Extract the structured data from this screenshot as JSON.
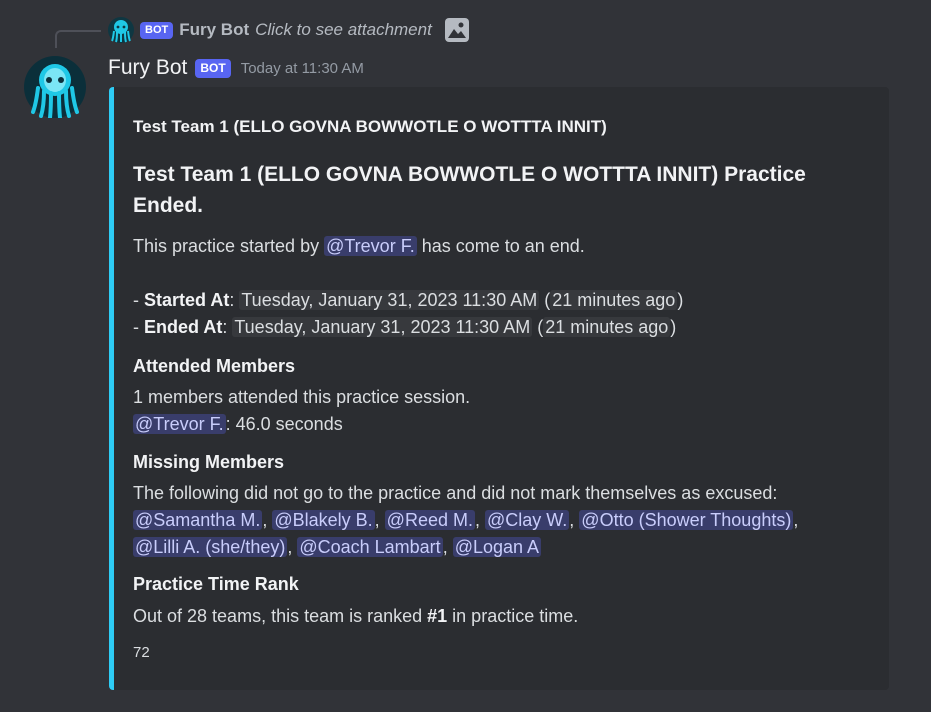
{
  "reply": {
    "author": "Fury Bot",
    "bot_tag": "BOT",
    "text": "Click to see attachment"
  },
  "message": {
    "author": "Fury Bot",
    "bot_tag": "BOT",
    "timestamp": "Today at 11:30 AM"
  },
  "embed": {
    "accent_color": "#2eccf5",
    "author": "Test Team 1 (ELLO GOVNA BOWWOTLE O WOTTTA INNIT)",
    "title": "Test Team 1 (ELLO GOVNA BOWWOTLE O WOTTTA INNIT) Practice Ended.",
    "description": {
      "prefix": "This practice started by ",
      "mention": "@Trevor F.",
      "suffix": " has come to an end."
    },
    "started": {
      "dash": "- ",
      "label": "Started At",
      "colon": ": ",
      "date": "Tuesday, January 31, 2023 11:30 AM",
      "relative": "21 minutes ago"
    },
    "ended": {
      "dash": "- ",
      "label": "Ended At",
      "colon": ": ",
      "date": "Tuesday, January 31, 2023 11:30 AM",
      "relative": "21 minutes ago"
    },
    "attended": {
      "name": "Attended Members",
      "summary": "1 members attended this practice session.",
      "member": "@Trevor F.",
      "duration": ": 46.0 seconds"
    },
    "missing": {
      "name": "Missing Members",
      "summary": "The following did not go to the practice and did not mark themselves as excused:",
      "members_row1": [
        "@Samantha M.",
        "@Blakely B.",
        "@Reed M.",
        "@Clay W.",
        "@Otto (Shower Thoughts)"
      ],
      "members_row2": [
        "@Lilli A. (she/they)",
        "@Coach Lambart",
        "@Logan A"
      ]
    },
    "rank": {
      "name": "Practice Time Rank",
      "prefix": "Out of 28 teams, this team is ranked ",
      "rank": "#1",
      "suffix": " in practice time."
    },
    "footer": "72"
  },
  "icons": {
    "avatar": "cthulhu-avatar-icon",
    "attachment": "image-icon"
  }
}
